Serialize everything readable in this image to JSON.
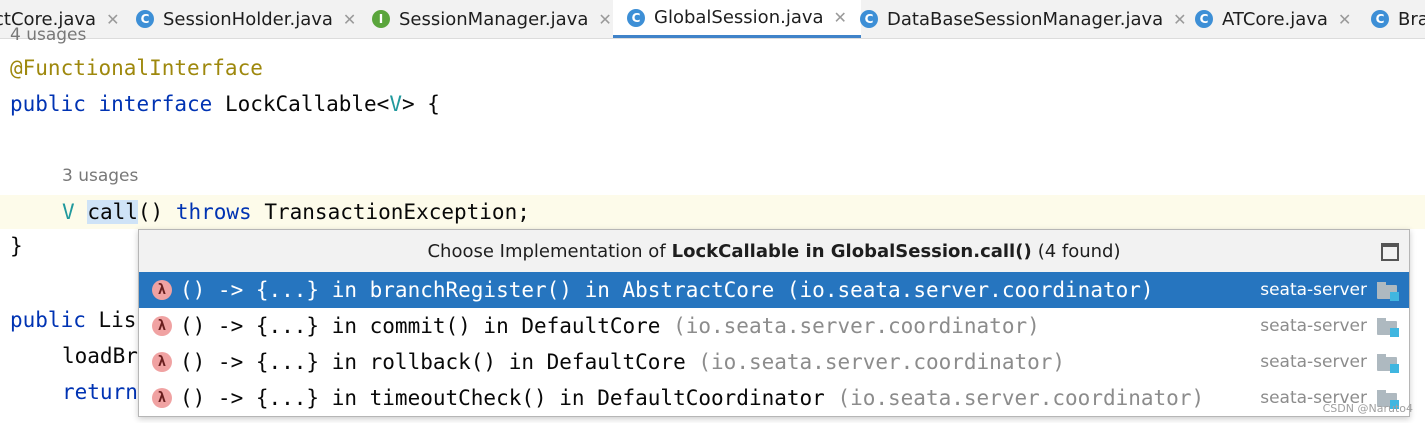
{
  "tabs": [
    {
      "label": "ctCore.java",
      "icon": "class-icon",
      "active": false
    },
    {
      "label": "SessionHolder.java",
      "icon": "class-icon",
      "active": false
    },
    {
      "label": "SessionManager.java",
      "icon": "interface-icon",
      "active": false
    },
    {
      "label": "GlobalSession.java",
      "icon": "class-icon",
      "active": true
    },
    {
      "label": "DataBaseSessionManager.java",
      "icon": "class-icon",
      "active": false
    },
    {
      "label": "ATCore.java",
      "icon": "class-icon",
      "active": false
    },
    {
      "label": "Bra",
      "icon": "class-icon",
      "active": false
    }
  ],
  "tab_icon_letters": {
    "class": "C",
    "interface": "I"
  },
  "close_glyph": "✕",
  "code": {
    "usages_top": "4 usages",
    "annotation": "@FunctionalInterface",
    "kw_public": "public",
    "kw_interface": "interface",
    "iface_name": "LockCallable<",
    "iface_type": "V",
    "iface_tail": "> {",
    "usages_method": "3 usages",
    "method_type": "V",
    "method_name": "call",
    "method_paren": "()",
    "kw_throws": "throws",
    "exception": "TransactionException;",
    "close_brace": "}",
    "line_public": "public Lis",
    "line_load": "loadBr",
    "line_return": "return"
  },
  "popup": {
    "title_prefix": "Choose Implementation of",
    "title_bold": "LockCallable in GlobalSession.call()",
    "title_suffix": "(4 found)",
    "items": [
      {
        "main": "() -> {...} in branchRegister() in AbstractCore",
        "pkg": "(io.seata.server.coordinator)",
        "module": "seata-server",
        "selected": true
      },
      {
        "main": "() -> {...} in commit() in DefaultCore",
        "pkg": "(io.seata.server.coordinator)",
        "module": "seata-server",
        "selected": false
      },
      {
        "main": "() -> {...} in rollback() in DefaultCore",
        "pkg": "(io.seata.server.coordinator)",
        "module": "seata-server",
        "selected": false
      },
      {
        "main": "() -> {...} in timeoutCheck() in DefaultCoordinator",
        "pkg": "(io.seata.server.coordinator)",
        "module": "seata-server",
        "selected": false
      }
    ],
    "lambda_glyph": "λ"
  },
  "watermark": "CSDN @Naruto4",
  "colors": {
    "accent": "#2675bf",
    "keyword": "#0033b3",
    "annotation": "#9e880d"
  }
}
